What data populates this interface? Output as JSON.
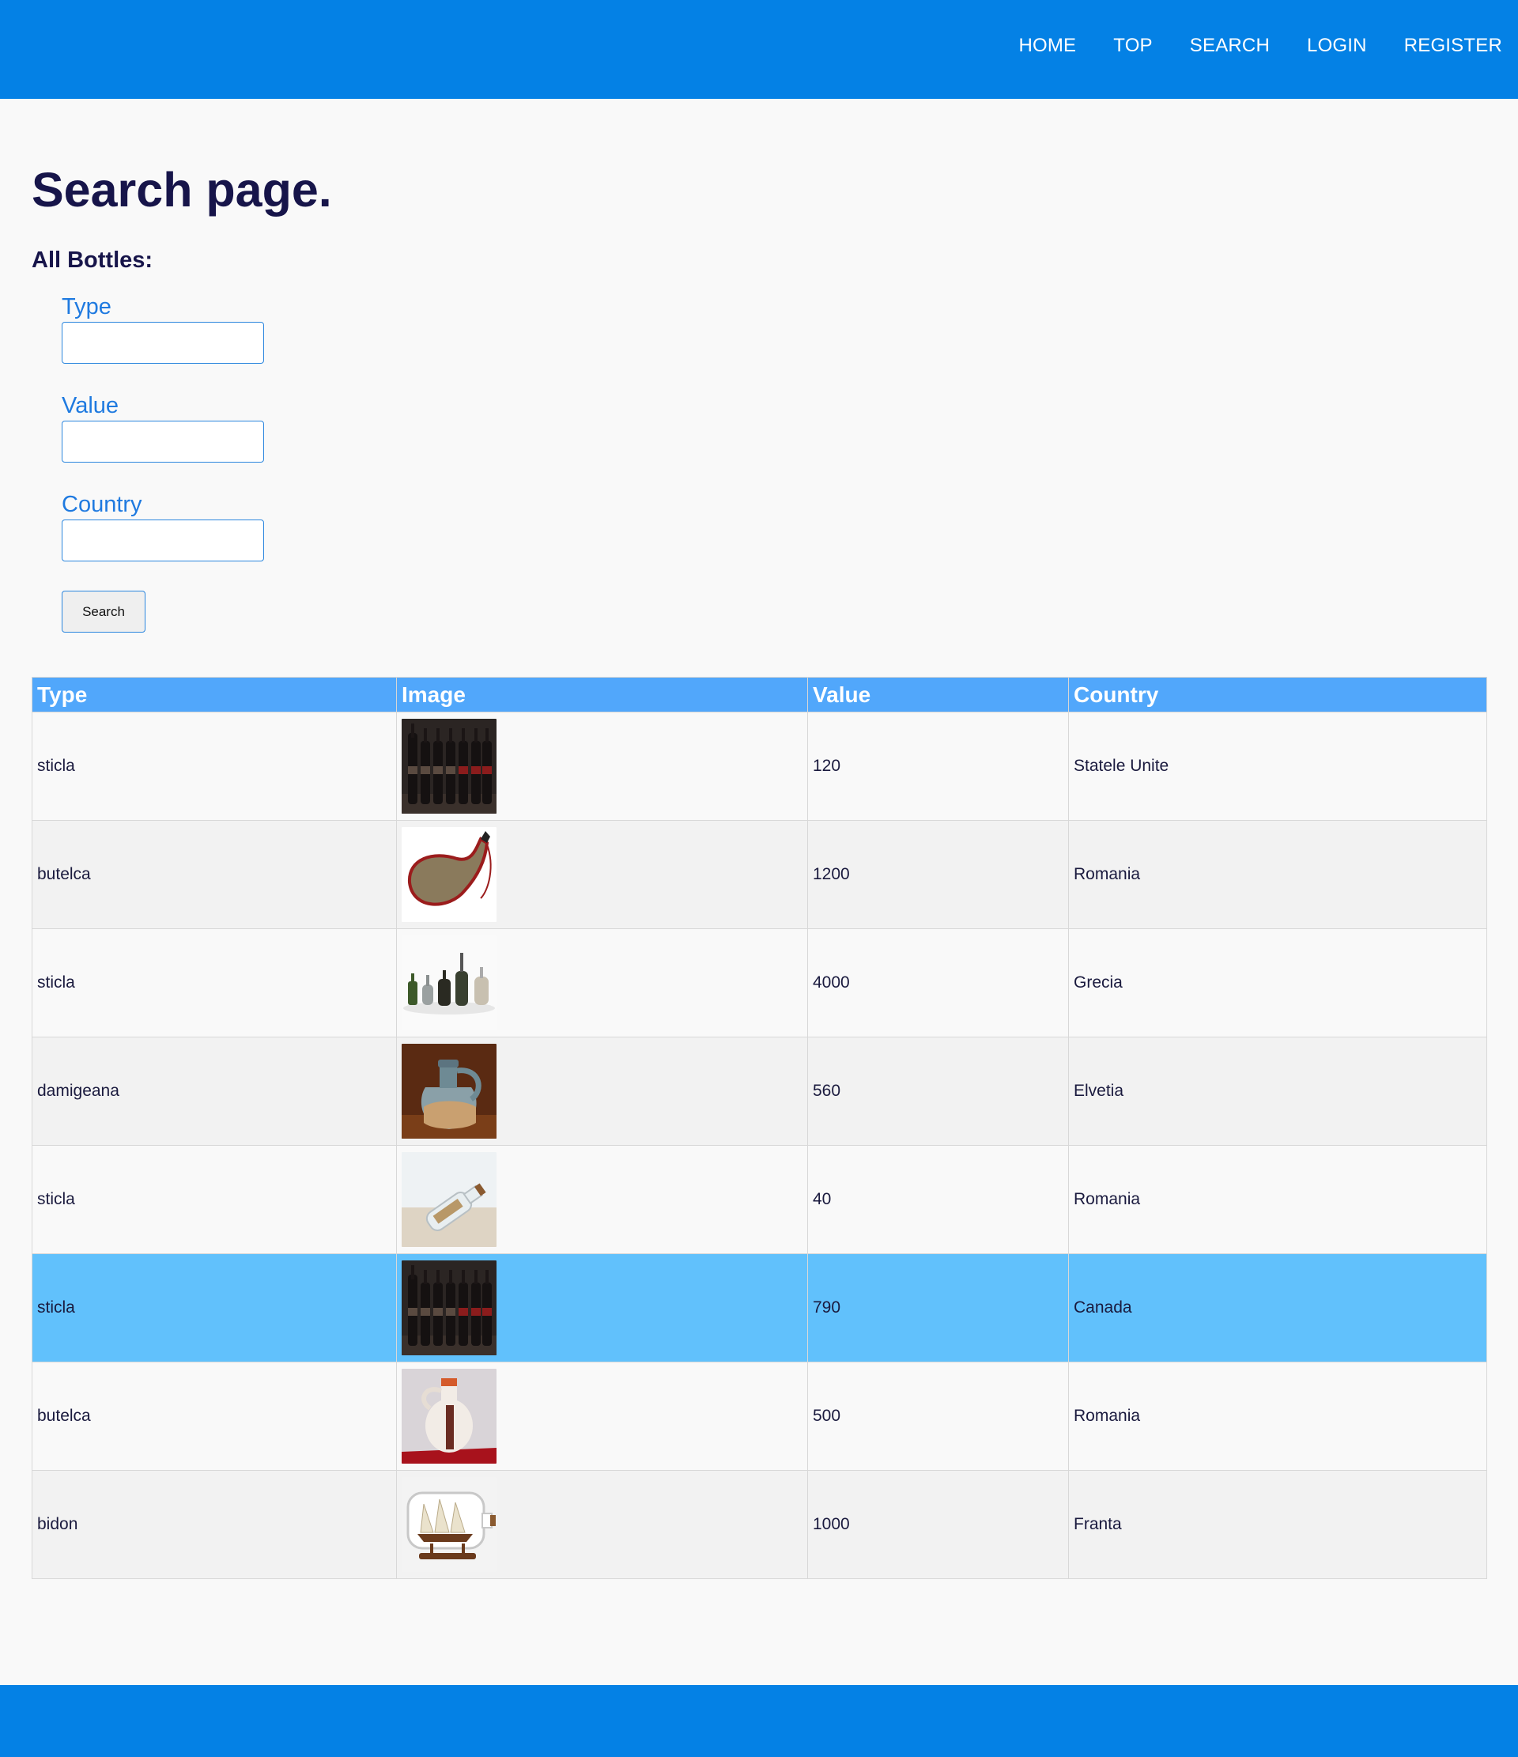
{
  "nav": {
    "items": [
      "HOME",
      "TOP",
      "SEARCH",
      "LOGIN",
      "REGISTER"
    ]
  },
  "page": {
    "title": "Search page.",
    "subtitle": "All Bottles:"
  },
  "form": {
    "type_label": "Type",
    "type_value": "",
    "value_label": "Value",
    "value_value": "",
    "country_label": "Country",
    "country_value": "",
    "search_button": "Search"
  },
  "table": {
    "headers": [
      "Type",
      "Image",
      "Value",
      "Country"
    ],
    "rows": [
      {
        "type": "sticla",
        "image": "dark-bottles-row",
        "value": "120",
        "country": "Statele Unite"
      },
      {
        "type": "butelca",
        "image": "leather-flask",
        "value": "1200",
        "country": "Romania"
      },
      {
        "type": "sticla",
        "image": "assorted-bottles",
        "value": "4000",
        "country": "Grecia"
      },
      {
        "type": "damigeana",
        "image": "ceramic-jug",
        "value": "560",
        "country": "Elvetia"
      },
      {
        "type": "sticla",
        "image": "message-bottle-sand",
        "value": "40",
        "country": "Romania"
      },
      {
        "type": "sticla",
        "image": "dark-bottles-row",
        "value": "790",
        "country": "Canada"
      },
      {
        "type": "butelca",
        "image": "painted-ceramic-flask",
        "value": "500",
        "country": "Romania"
      },
      {
        "type": "bidon",
        "image": "ship-in-bottle",
        "value": "1000",
        "country": "Franta"
      }
    ],
    "highlighted_row": 5
  },
  "colors": {
    "header_bg": "#0481e5",
    "table_header_bg": "#51a7fb",
    "row_highlight": "#61c1fc",
    "label_blue": "#1f7ae0",
    "title_dark": "#17154a"
  }
}
